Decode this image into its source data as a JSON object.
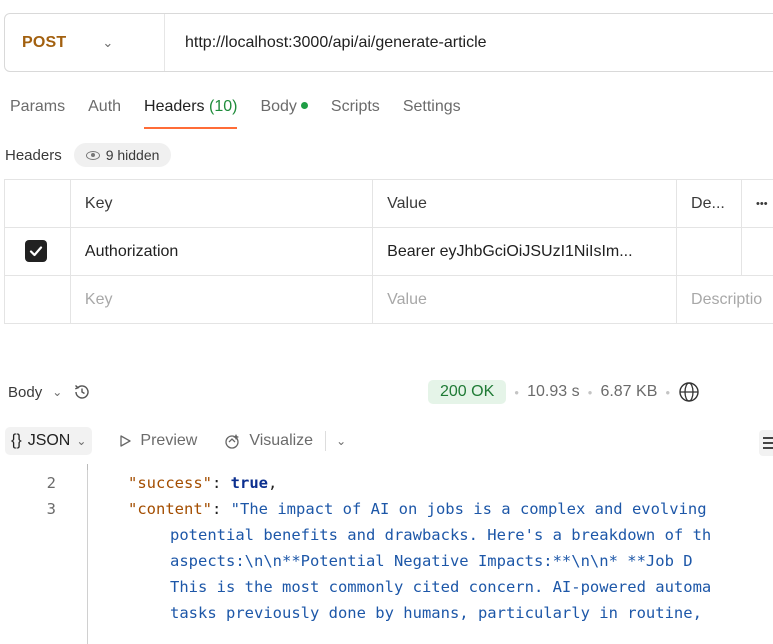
{
  "request": {
    "method": "POST",
    "url": "http://localhost:3000/api/ai/generate-article"
  },
  "tabs": [
    {
      "label": "Params"
    },
    {
      "label": "Auth"
    },
    {
      "label": "Headers",
      "count": "(10)"
    },
    {
      "label": "Body"
    },
    {
      "label": "Scripts"
    },
    {
      "label": "Settings"
    }
  ],
  "headers_section": {
    "label": "Headers",
    "hidden_label": "9 hidden"
  },
  "table": {
    "columns": {
      "key": "Key",
      "value": "Value",
      "description": "De..."
    },
    "rows": [
      {
        "checked": true,
        "key": "Authorization",
        "value": "Bearer eyJhbGciOiJSUzI1NiIsIm..."
      }
    ],
    "empty_row": {
      "key": "Key",
      "value": "Value",
      "description": "Descriptio"
    }
  },
  "response": {
    "label": "Body",
    "status": "200 OK",
    "time": "10.93 s",
    "size": "6.87 KB"
  },
  "viewer": {
    "format": "JSON",
    "format_icon": "{}",
    "preview": "Preview",
    "visualize": "Visualize"
  },
  "code": {
    "lines": [
      {
        "n": "2",
        "key": "\"success\"",
        "sep": ": ",
        "value": "true",
        "tail": ","
      },
      {
        "n": "3",
        "key": "\"content\"",
        "sep": ": ",
        "value": "\"The impact of AI on jobs is a complex and evolving"
      }
    ],
    "continuation": [
      "potential benefits and drawbacks. Here's a breakdown of th",
      "aspects:\\n\\n**Potential Negative Impacts:**\\n\\n*   **Job D",
      "This is the most commonly cited concern. AI-powered automa",
      "tasks previously done by humans, particularly in routine,"
    ]
  },
  "colors": {
    "accent": "#ff6c37",
    "method": "#a2600f",
    "success": "#1f7a35"
  }
}
